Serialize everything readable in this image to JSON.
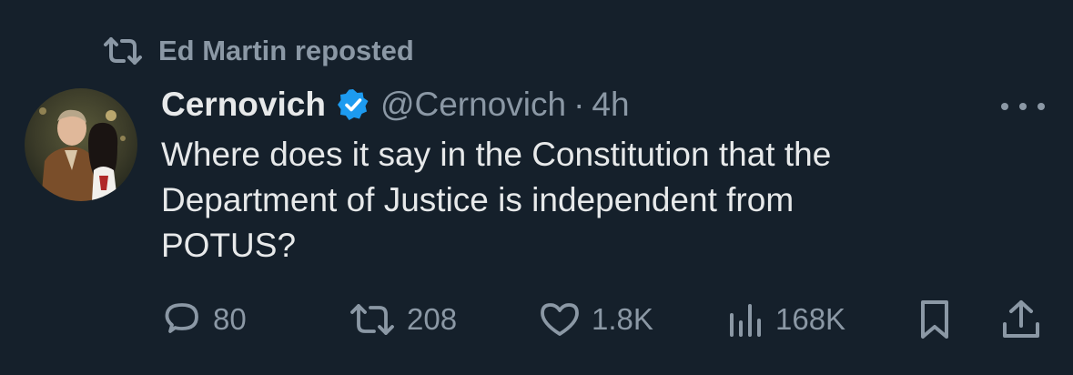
{
  "repost": {
    "text": "Ed Martin reposted",
    "icon": "retweet-icon"
  },
  "author": {
    "name": "Cernovich",
    "verified_icon": "verified-badge-icon",
    "verified_color": "#1d9bf0",
    "handle": "@Cernovich",
    "separator": "·",
    "time": "4h"
  },
  "tweet": {
    "text": "Where does it say in the Constitution that the\nDepartment of Justice is independent from\nPOTUS?"
  },
  "actions": {
    "reply": {
      "icon": "reply-icon",
      "count": "80"
    },
    "retweet": {
      "icon": "retweet-icon",
      "count": "208"
    },
    "like": {
      "icon": "heart-icon",
      "count": "1.8K"
    },
    "views": {
      "icon": "views-icon",
      "count": "168K"
    },
    "bookmark": {
      "icon": "bookmark-icon"
    },
    "share": {
      "icon": "share-icon"
    }
  },
  "more_icon": "more-options-icon",
  "colors": {
    "background": "#15202b",
    "primary_text": "#e7e9ea",
    "secondary_text": "#8b98a5",
    "accent": "#1d9bf0"
  }
}
